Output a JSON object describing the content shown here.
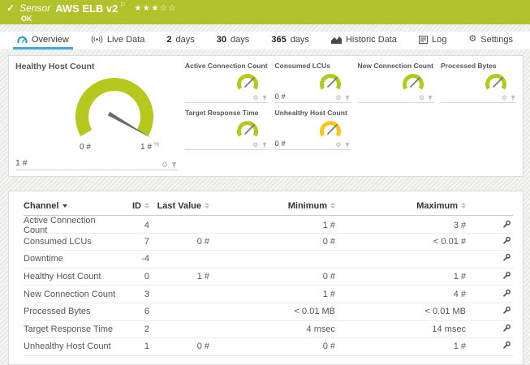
{
  "header": {
    "status_icon": "✓",
    "kind_label": "Sensor",
    "sensor_name": "AWS ELB v2",
    "flag_icon": "⚐",
    "stars_filled": "★★★",
    "stars_empty": "☆☆",
    "status_text": "OK"
  },
  "colors": {
    "header_green": "#b0c32c",
    "gauge_green": "#b4c91c",
    "gauge_warning_yellow": "#fcc41d",
    "tab_active_underline": "#41a8dc",
    "needle_grey": "#6b6b6b"
  },
  "tabs": {
    "items": [
      {
        "label": "Overview",
        "icon": "gauge-icon",
        "active": true
      },
      {
        "label": "Live Data",
        "icon": "live-signal-icon",
        "active": false
      },
      {
        "num": "2",
        "label": "days",
        "active": false
      },
      {
        "num": "30",
        "label": "days",
        "active": false
      },
      {
        "num": "365",
        "label": "days",
        "active": false
      },
      {
        "label": "Historic Data",
        "icon": "area-chart-icon",
        "active": false
      },
      {
        "label": "Log",
        "icon": "log-list-icon",
        "active": false
      },
      {
        "label": "Settings",
        "icon": "gear-icon",
        "active": false
      }
    ]
  },
  "gauges": {
    "primary": {
      "title": "Healthy Host Count",
      "value": "1 #",
      "scale_min": "0 #",
      "scale_max": "1 #",
      "needle_marker": "%",
      "color": "#b4c91c"
    },
    "small": [
      {
        "title": "Active Connection Count",
        "value": "",
        "color": "#b4c91c"
      },
      {
        "title": "Consumed LCUs",
        "value": "0 #",
        "color": "#b4c91c"
      },
      {
        "title": "New Connection Count",
        "value": "",
        "color": "#b4c91c"
      },
      {
        "title": "Processed Bytes",
        "value": "",
        "color": "#b4c91c"
      },
      {
        "title": "Target Response Time",
        "value": "",
        "color": "#b4c91c"
      },
      {
        "title": "Unhealthy Host Count",
        "value": "0 #",
        "color": "#fcc41d"
      }
    ]
  },
  "table": {
    "headers": {
      "channel": "Channel",
      "id": "ID",
      "last_value": "Last Value",
      "minimum": "Minimum",
      "maximum": "Maximum"
    },
    "rows": [
      {
        "channel": "Active Connection Count",
        "id": "4",
        "last_value": "",
        "minimum": "1 #",
        "maximum": "3 #"
      },
      {
        "channel": "Consumed LCUs",
        "id": "7",
        "last_value": "0 #",
        "minimum": "0 #",
        "maximum": "< 0.01 #"
      },
      {
        "channel": "Downtime",
        "id": "-4",
        "last_value": "",
        "minimum": "",
        "maximum": ""
      },
      {
        "channel": "Healthy Host Count",
        "id": "0",
        "last_value": "1 #",
        "minimum": "0 #",
        "maximum": "1 #"
      },
      {
        "channel": "New Connection Count",
        "id": "3",
        "last_value": "",
        "minimum": "1 #",
        "maximum": "4 #"
      },
      {
        "channel": "Processed Bytes",
        "id": "6",
        "last_value": "",
        "minimum": "< 0.01 MB",
        "maximum": "< 0.01 MB"
      },
      {
        "channel": "Target Response Time",
        "id": "2",
        "last_value": "",
        "minimum": "4 msec",
        "maximum": "14 msec"
      },
      {
        "channel": "Unhealthy Host Count",
        "id": "1",
        "last_value": "0 #",
        "minimum": "0 #",
        "maximum": "1 #"
      }
    ]
  }
}
